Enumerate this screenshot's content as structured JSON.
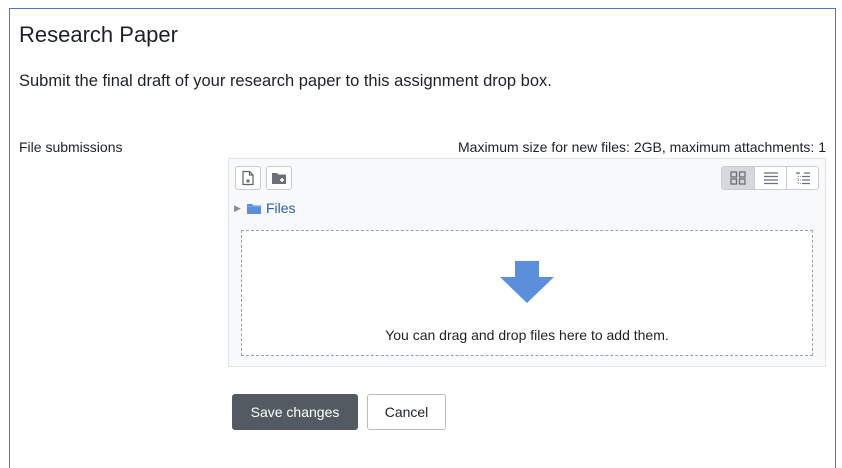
{
  "assignment": {
    "title": "Research Paper",
    "intro": "Submit the final draft of your research paper to this assignment drop box."
  },
  "form": {
    "field_label": "File submissions",
    "max_info": "Maximum size for new files: 2GB, maximum attachments: 1"
  },
  "filemanager": {
    "toolbar": {
      "add_icon": "add-file-icon",
      "create_folder_icon": "create-folder-icon",
      "views": [
        {
          "icon": "icons-view-icon",
          "active": true
        },
        {
          "icon": "list-view-icon",
          "active": false
        },
        {
          "icon": "tree-view-icon",
          "active": false
        }
      ]
    },
    "path": {
      "folder_icon": "folder-icon",
      "label": "Files"
    },
    "drop": {
      "icon": "down-arrow-icon",
      "text": "You can drag and drop files here to add them."
    }
  },
  "buttons": {
    "save": "Save changes",
    "cancel": "Cancel"
  },
  "colors": {
    "frame_border": "#4a7ab8",
    "primary_button": "#545a61",
    "arrow": "#5b8fd9",
    "folder": "#5b8fd9",
    "link": "#2a5ea8"
  }
}
